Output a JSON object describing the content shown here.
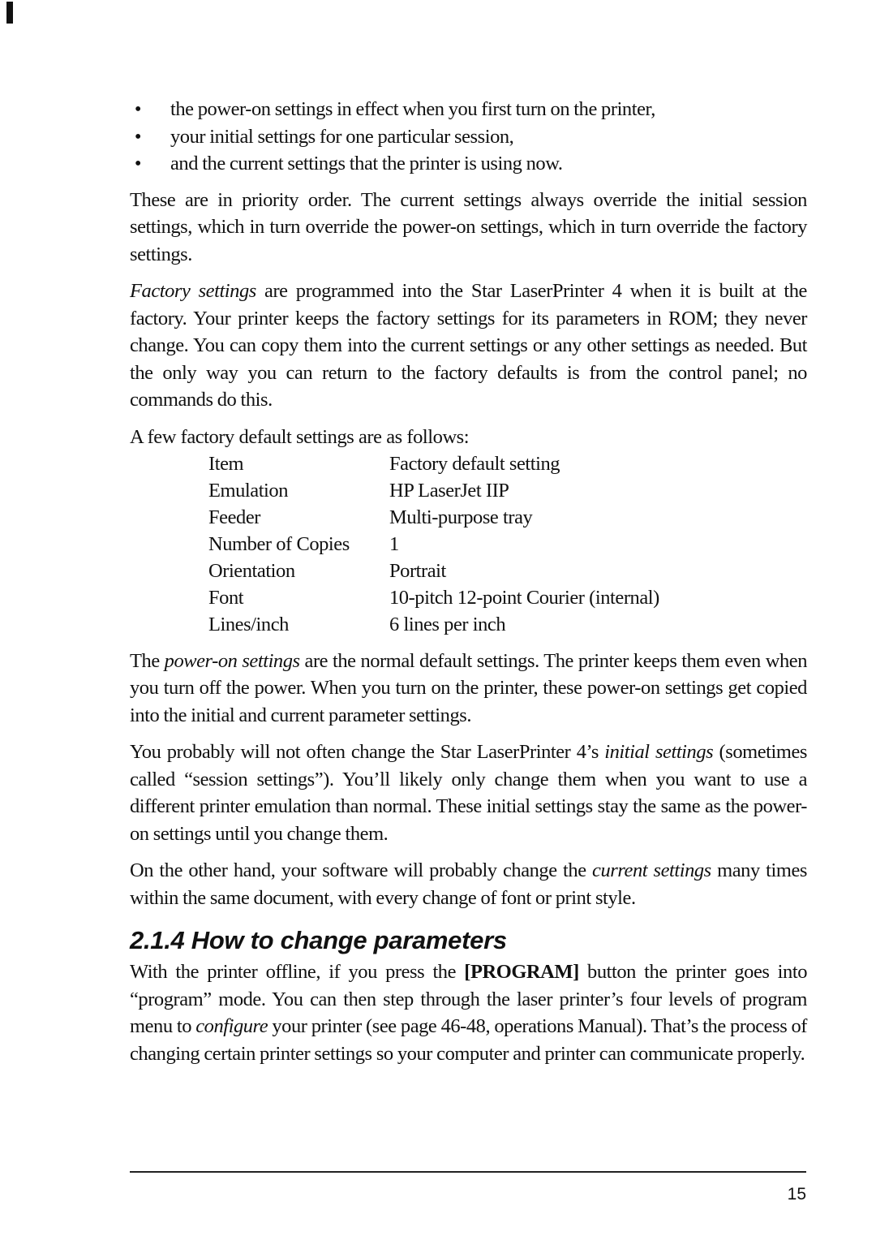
{
  "bullets": [
    "the power-on settings in effect when you first turn on the printer,",
    "your initial settings for one particular session,",
    "and the current settings that the printer is using now."
  ],
  "bullet_glyph": "•",
  "para_priority": "These are in priority order. The current settings always override the initial session settings, which in turn override the power-on settings, which in turn override the factory settings.",
  "para_factory": {
    "em": "Factory settings",
    "rest": " are programmed into the Star LaserPrinter 4 when it is built at the factory. Your printer keeps the factory settings for its parameters in ROM; they never change. You can copy them into the current settings or any other settings as needed. But the only way you can return to the factory defaults is from the control panel; no commands do this."
  },
  "defaults_intro": "A few factory default settings are as follows:",
  "defaults_table": {
    "header": {
      "item": "Item",
      "value": "Factory default setting"
    },
    "rows": [
      {
        "item": "Emulation",
        "value": "HP LaserJet IIP"
      },
      {
        "item": "Feeder",
        "value": "Multi-purpose tray"
      },
      {
        "item": "Number of Copies",
        "value": "1"
      },
      {
        "item": "Orientation",
        "value": "Portrait"
      },
      {
        "item": "Font",
        "value": "10-pitch 12-point Courier (internal)"
      },
      {
        "item": "Lines/inch",
        "value": "6 lines per inch"
      }
    ]
  },
  "para_poweron": {
    "pre": "The ",
    "em": "power-on settings",
    "rest": " are the normal default settings. The printer keeps them even when you turn off the power. When you turn on the printer, these power-on settings get copied into the initial and current parameter settings."
  },
  "para_initial": {
    "pre": "You probably will not often change the Star LaserPrinter 4’s ",
    "em": "initial settings",
    "rest": " (sometimes called “session settings”). You’ll likely only change them when you want to use a different printer emulation than normal. These initial settings stay the same as the power-on settings until you change them."
  },
  "para_current": {
    "pre": "On the other hand, your software will probably change the ",
    "em": "current settings",
    "rest": " many times within the same document, with every change of font or print style."
  },
  "section_heading": "2.1.4 How to change parameters",
  "para_program": {
    "pre": "With the printer offline, if you press the ",
    "bold": "[PROGRAM]",
    "mid": " button the printer goes into “program” mode. You can then step through the laser printer’s four levels of  program menu to ",
    "em": "configure",
    "rest": " your printer (see page 46-48, operations Manual). That’s the process of changing certain printer settings so your computer and printer can communicate properly."
  },
  "page_number": "15"
}
